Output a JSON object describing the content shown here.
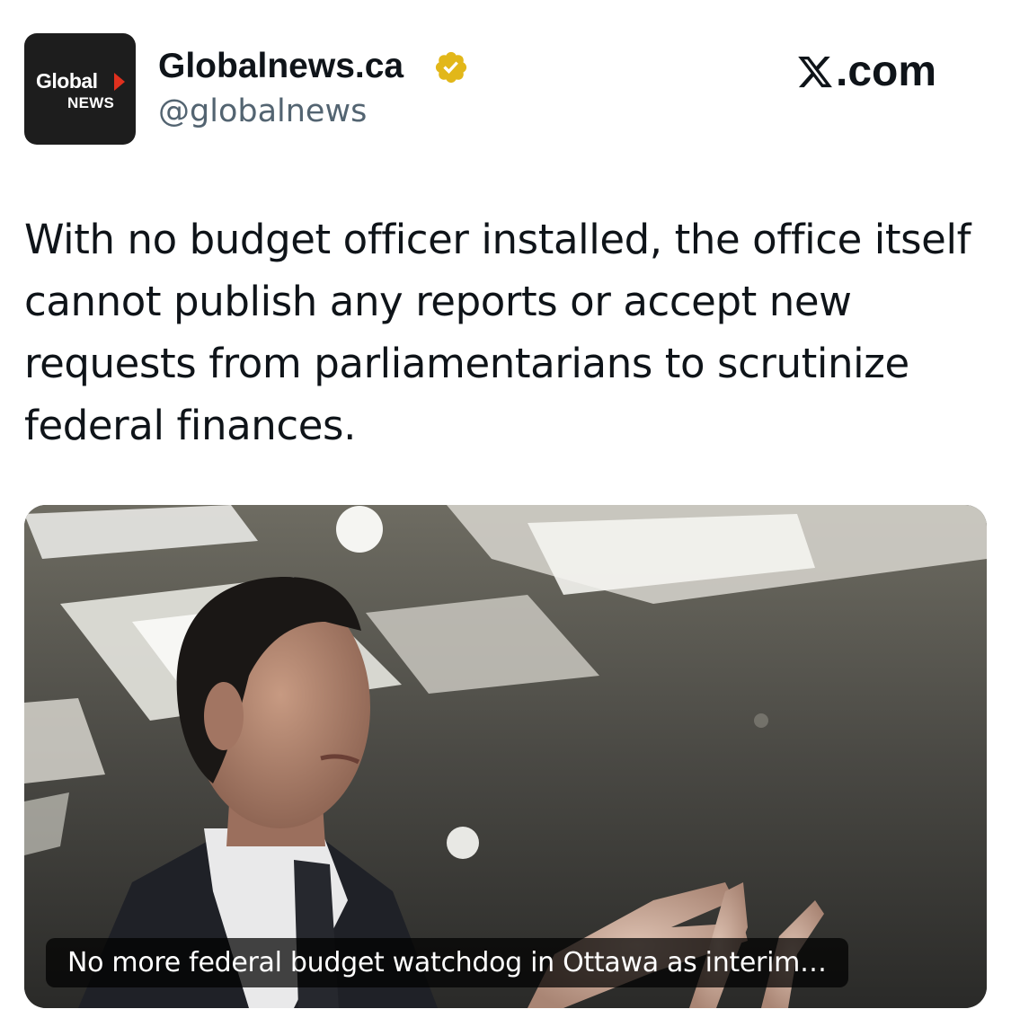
{
  "account": {
    "logo_line1": "Global",
    "logo_line2": "NEWS",
    "display_name": "Globalnews.ca",
    "handle": "@globalnews",
    "verified": true
  },
  "brand": {
    "site": ".com",
    "icon": "x-logo-icon"
  },
  "tweet": {
    "text": "With no budget officer installed, the office itself cannot publish any reports or accept new requests from parliamentarians to scrutinize federal finances."
  },
  "link_card": {
    "caption": "No more federal budget watchdog in Ottawa as interim…",
    "image": "photo-of-man-in-suit-gesturing"
  },
  "colors": {
    "text": "#0f1419",
    "secondary_text": "#536471",
    "verified_gold": "#e2b719",
    "logo_red": "#e0301e"
  }
}
